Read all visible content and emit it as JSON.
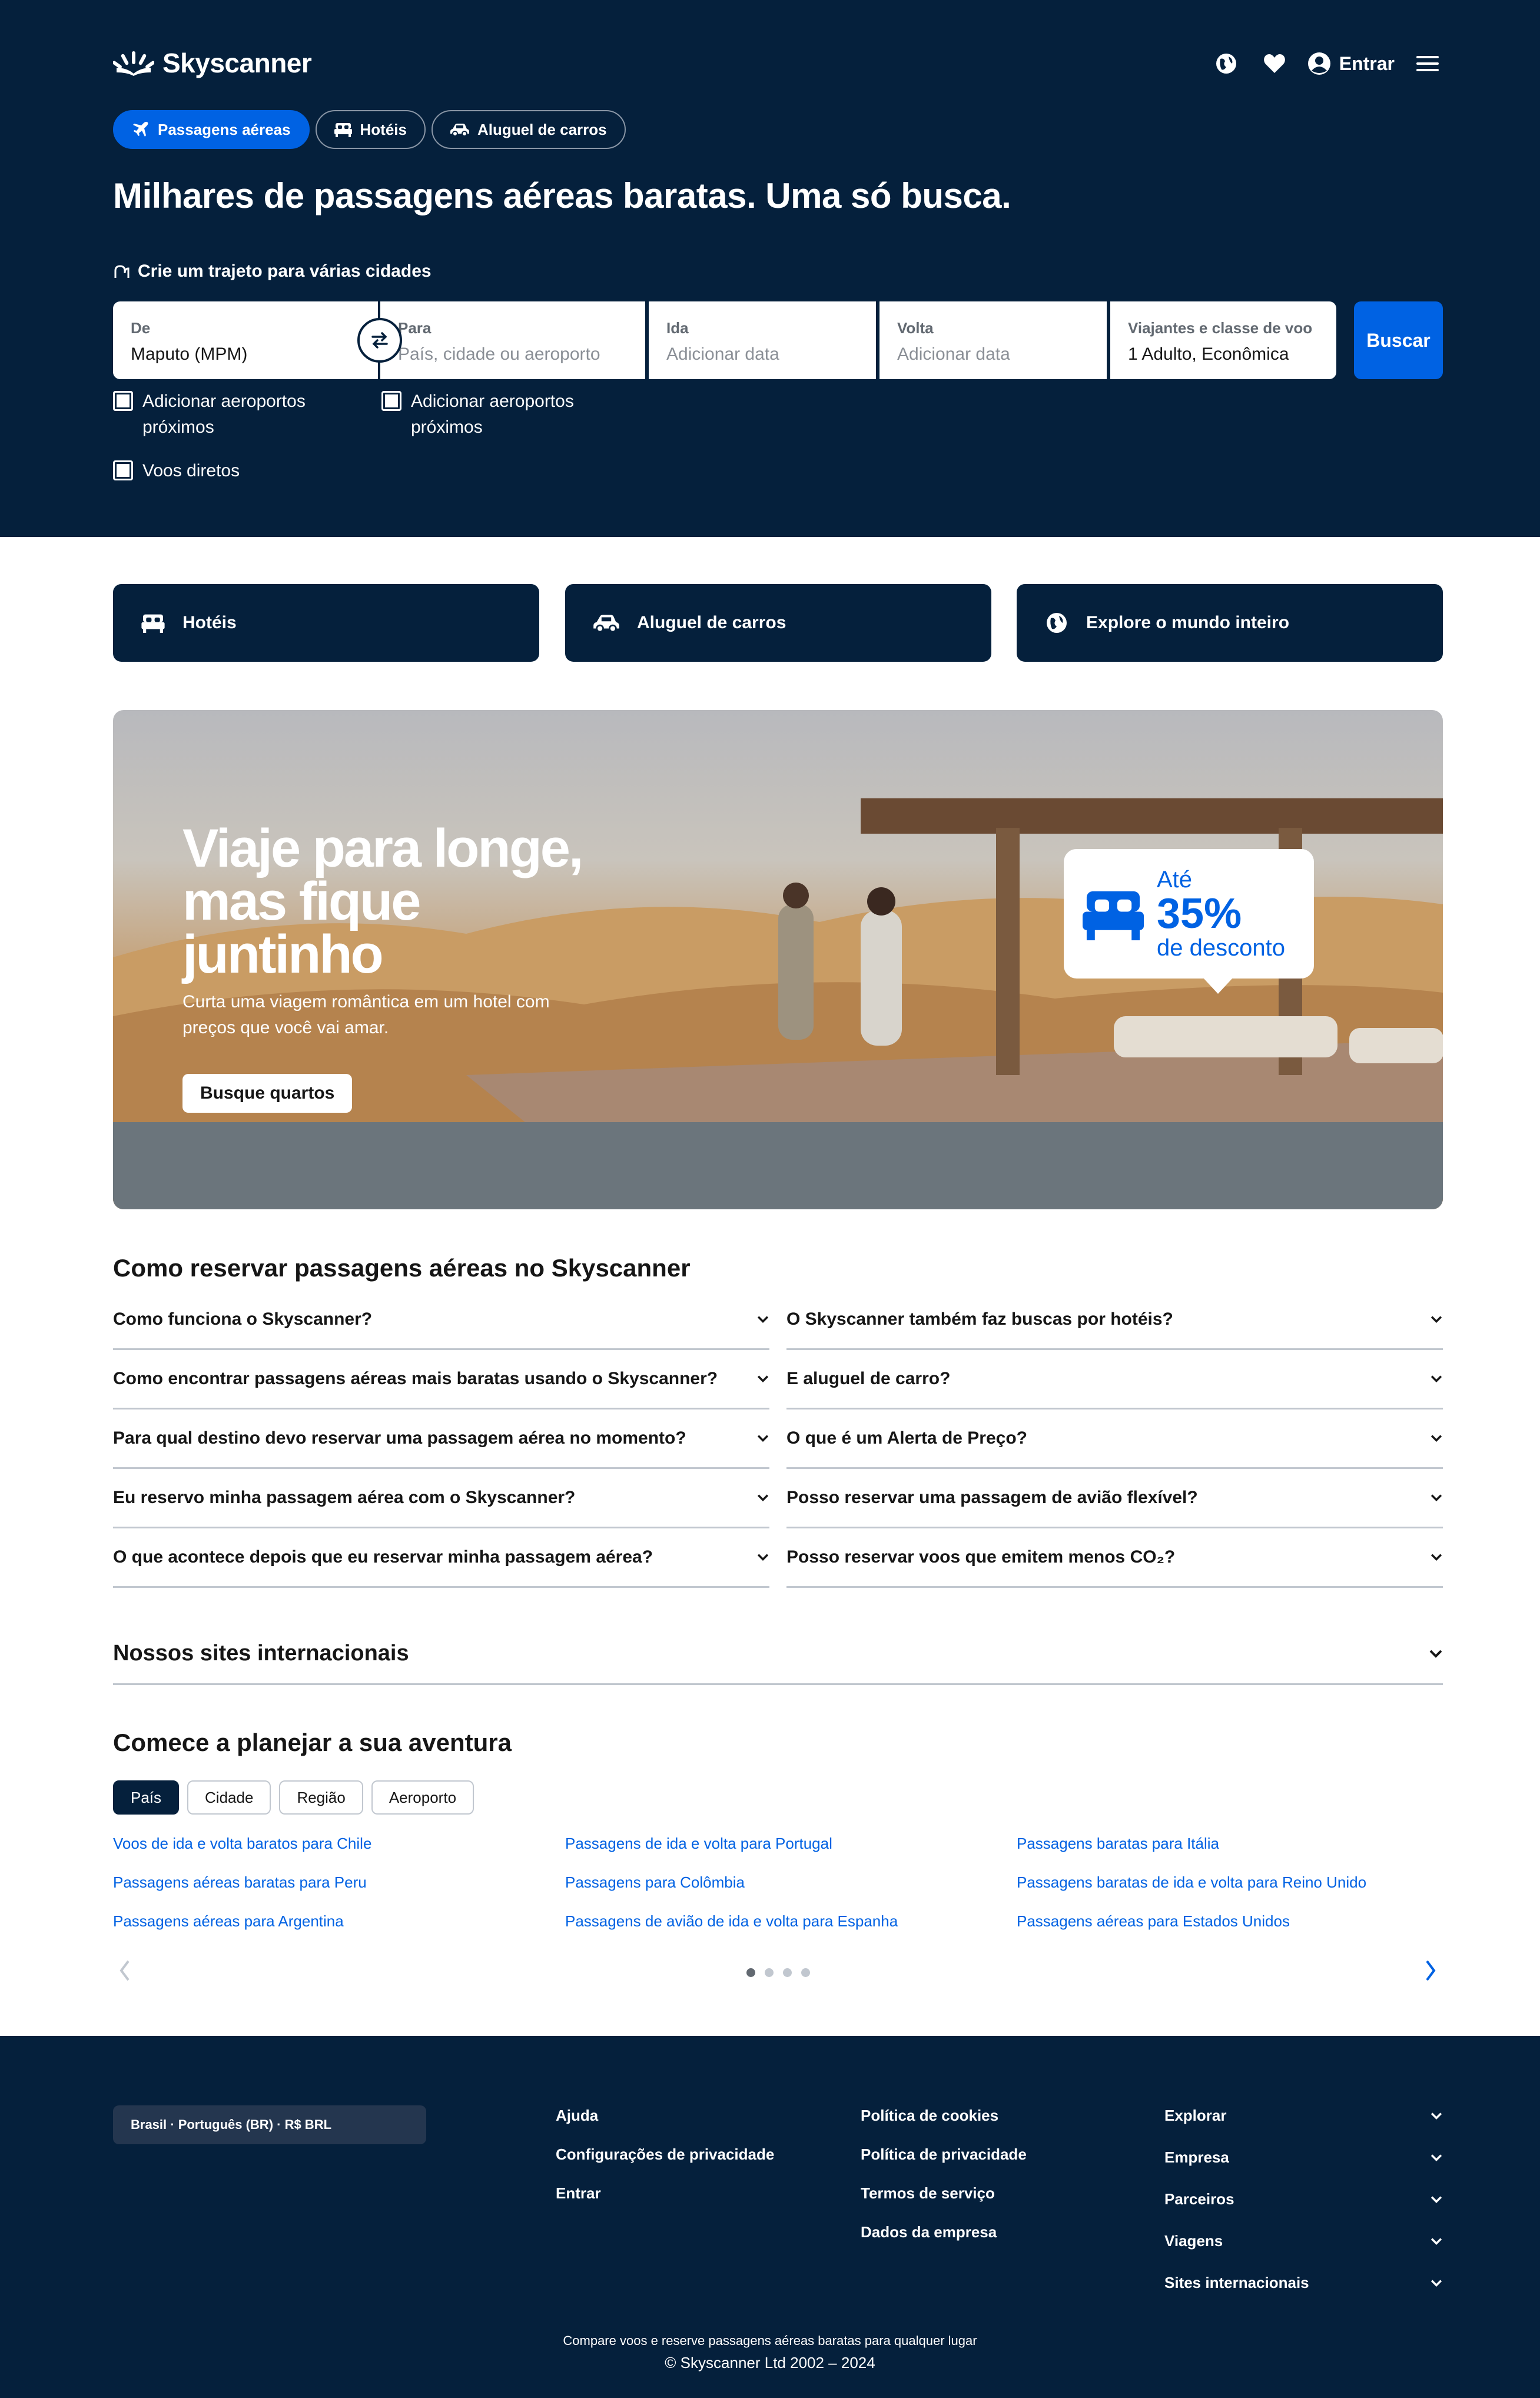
{
  "brand": {
    "name": "Skyscanner"
  },
  "topnav": {
    "signin_label": "Entrar"
  },
  "tabs": [
    {
      "label": "Passagens aéreas"
    },
    {
      "label": "Hotéis"
    },
    {
      "label": "Aluguel de carros"
    }
  ],
  "headline": "Milhares de passagens aéreas baratas. Uma só busca.",
  "multicity_label": "Crie um trajeto para várias cidades",
  "search": {
    "from": {
      "label": "De",
      "value": "Maputo (MPM)"
    },
    "to": {
      "label": "Para",
      "placeholder": "País, cidade ou aeroporto"
    },
    "depart": {
      "label": "Ida",
      "placeholder": "Adicionar data"
    },
    "return": {
      "label": "Volta",
      "placeholder": "Adicionar data"
    },
    "travellers": {
      "label": "Viajantes e classe de voo",
      "value": "1 Adulto, Econômica"
    },
    "button": "Buscar",
    "nearby_from": "Adicionar aeroportos próximos",
    "nearby_to": "Adicionar aeroportos próximos",
    "direct": "Voos diretos"
  },
  "quick_cards": [
    {
      "label": "Hotéis"
    },
    {
      "label": "Aluguel de carros"
    },
    {
      "label": "Explore o mundo inteiro"
    }
  ],
  "banner": {
    "title_line1": "Viaje para longe,",
    "title_line2": "mas fique",
    "title_line3": "juntinho",
    "subtitle": "Curta uma viagem romântica em um hotel com preços que você vai amar.",
    "button": "Busque quartos",
    "promo_line1": "Até",
    "promo_line2": "35%",
    "promo_line3": "de desconto"
  },
  "faq": {
    "title": "Como reservar passagens aéreas no Skyscanner",
    "left": [
      "Como funciona o Skyscanner?",
      "Como encontrar passagens aéreas mais baratas usando o Skyscanner?",
      "Para qual destino devo reservar uma passagem aérea no momento?",
      "Eu reservo minha passagem aérea com o Skyscanner?",
      "O que acontece depois que eu reservar minha passagem aérea?"
    ],
    "right": [
      "O Skyscanner também faz buscas por hotéis?",
      "E aluguel de carro?",
      "O que é um Alerta de Preço?",
      "Posso reservar uma passagem de avião flexível?",
      "Posso reservar voos que emitem menos CO₂?"
    ]
  },
  "intl_sites": "Nossos sites internacionais",
  "plan": {
    "title": "Comece a planejar a sua aventura",
    "pills": [
      "País",
      "Cidade",
      "Região",
      "Aeroporto"
    ],
    "col1": [
      "Voos de ida e volta baratos para Chile",
      "Passagens aéreas baratas para Peru",
      "Passagens aéreas para Argentina"
    ],
    "col2": [
      "Passagens de ida e volta para Portugal",
      "Passagens para Colômbia",
      "Passagens de avião de ida e volta para Espanha"
    ],
    "col3": [
      "Passagens baratas para Itália",
      "Passagens baratas de ida e volta para Reino Unido",
      "Passagens aéreas para Estados Unidos"
    ],
    "page_current": 1,
    "page_total": 4
  },
  "footer": {
    "locale": "Brasil · Português (BR) · R$ BRL",
    "col1": [
      "Ajuda",
      "Configurações de privacidade",
      "Entrar"
    ],
    "col2": [
      "Política de cookies",
      "Política de privacidade",
      "Termos de serviço",
      "Dados da empresa"
    ],
    "expandables": [
      "Explorar",
      "Empresa",
      "Parceiros",
      "Viagens",
      "Sites internacionais"
    ],
    "tagline": "Compare voos e reserve passagens aéreas baratas para qualquer lugar",
    "copyright": "© Skyscanner Ltd 2002 – 2024"
  },
  "colors": {
    "navy": "#05203c",
    "blue": "#0062e3",
    "white": "#ffffff"
  }
}
